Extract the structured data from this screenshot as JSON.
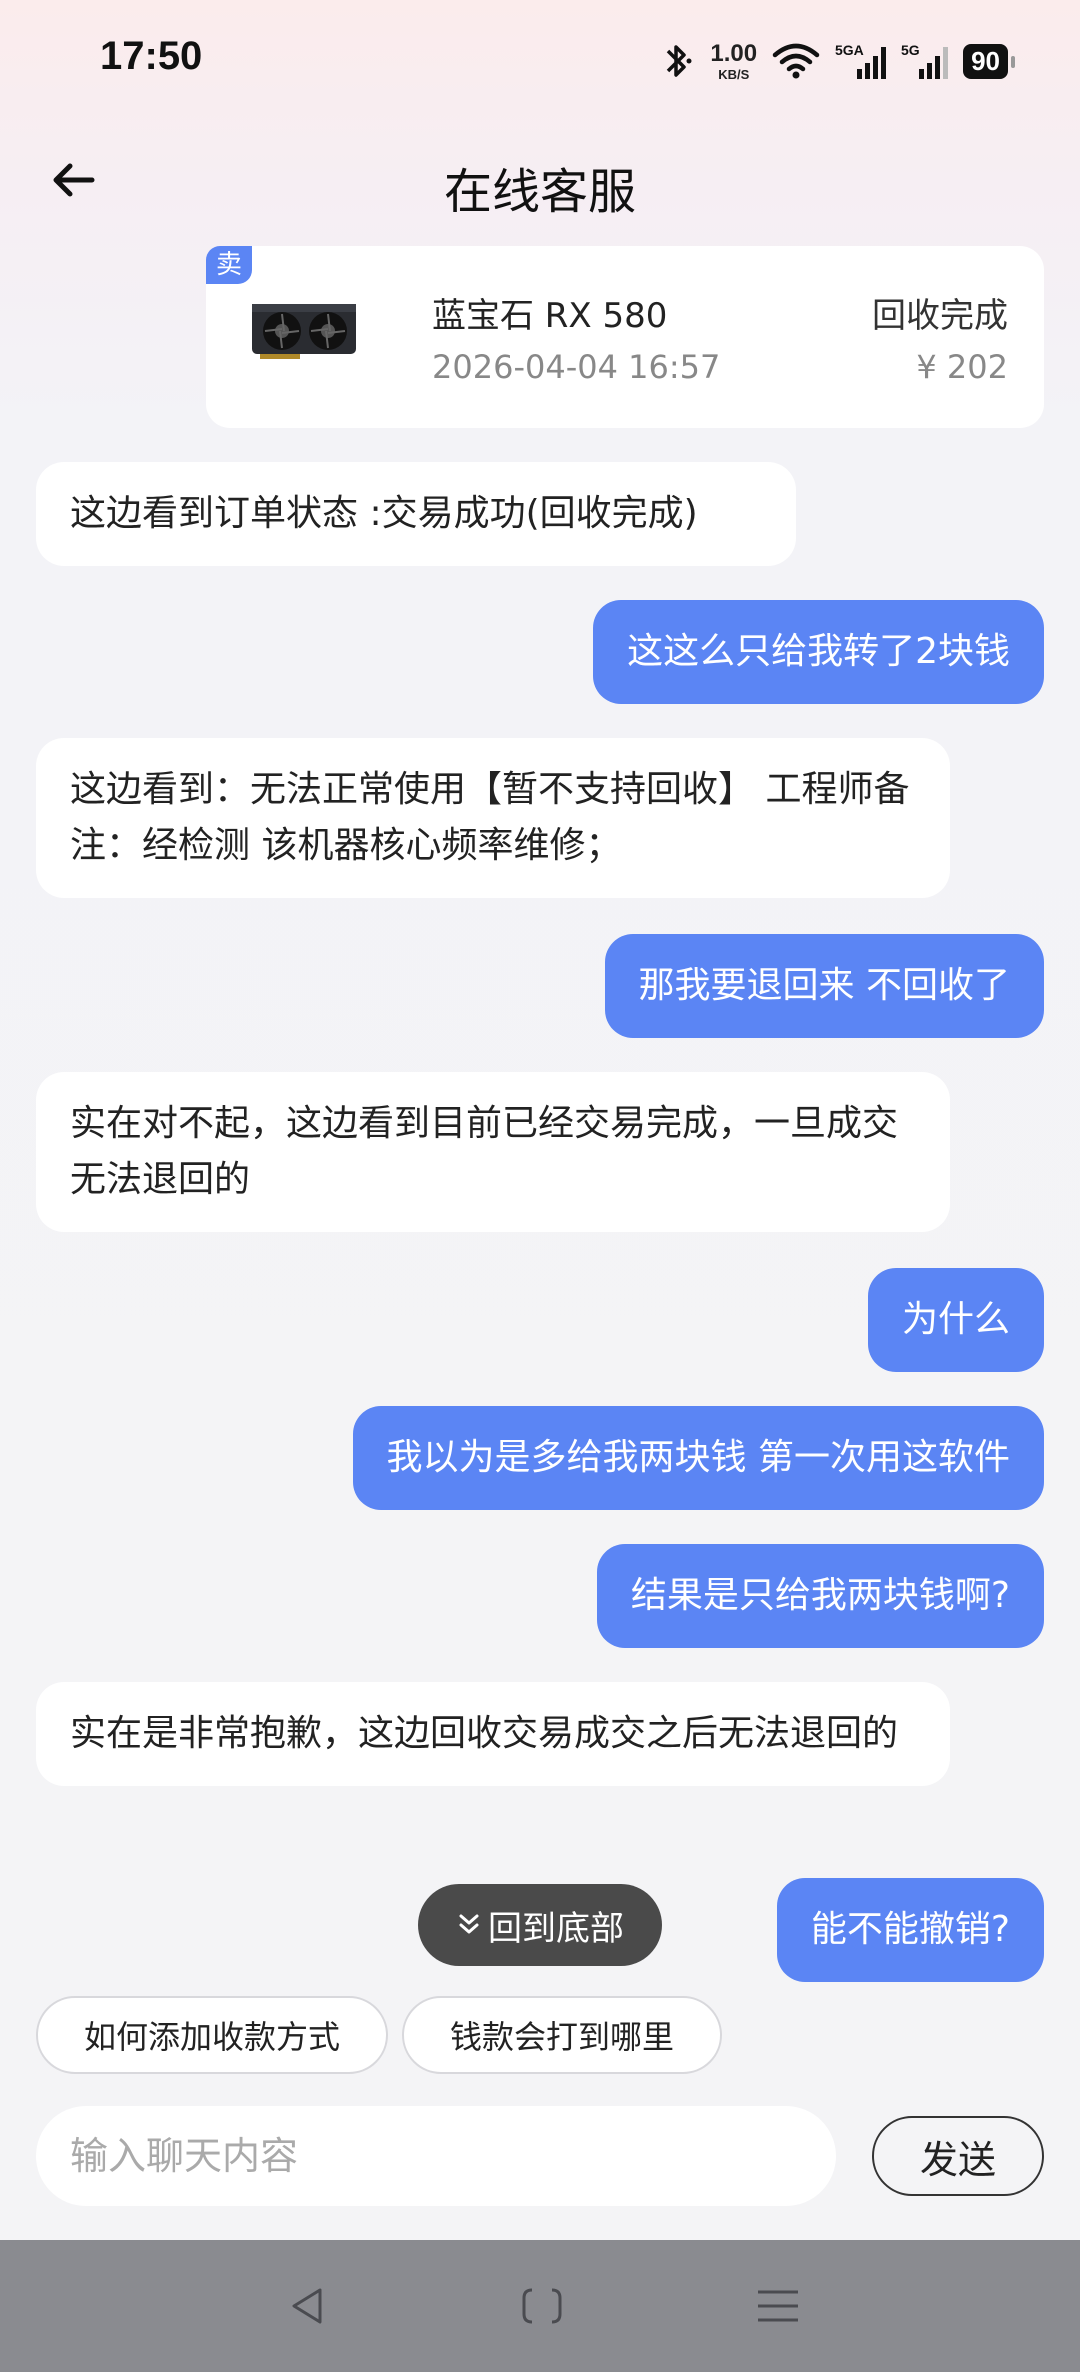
{
  "status_bar": {
    "time": "17:50",
    "net_speed": "1.00",
    "net_unit": "KB/S",
    "signal1": "5GA",
    "signal2": "5G",
    "battery": "90"
  },
  "header": {
    "title": "在线客服"
  },
  "order": {
    "tag": "卖",
    "product": "蓝宝石 RX 580",
    "date": "2026-04-04 16:57",
    "status": "回收完成",
    "price": "¥ 202"
  },
  "messages": [
    {
      "from": "agent",
      "text": "这边看到订单状态 :交易成功(回收完成)"
    },
    {
      "from": "user",
      "text": "这这么只给我转了2块钱"
    },
    {
      "from": "agent",
      "text": "这边看到：无法正常使用【暂不支持回收】 工程师备注：经检测 该机器核心频率维修；"
    },
    {
      "from": "user",
      "text": "那我要退回来 不回收了"
    },
    {
      "from": "agent",
      "text": "实在对不起，这边看到目前已经交易完成，一旦成交无法退回的"
    },
    {
      "from": "user",
      "text": "为什么"
    },
    {
      "from": "user",
      "text": "我以为是多给我两块钱 第一次用这软件"
    },
    {
      "from": "user",
      "text": "结果是只给我两块钱啊?"
    },
    {
      "from": "agent",
      "text": "实在是非常抱歉，这边回收交易成交之后无法退回的"
    },
    {
      "from": "user",
      "text": "能不能撤销?"
    }
  ],
  "scroll_to_bottom": {
    "icon": "double-chevron-down-icon",
    "label": "回到底部"
  },
  "quick_replies": [
    "如何添加收款方式",
    "钱款会打到哪里"
  ],
  "composer": {
    "placeholder": "输入聊天内容",
    "send_label": "发送"
  },
  "colors": {
    "accent": "#5b85f4",
    "agent_bubble": "#ffffff",
    "nav_bar": "#8a8b90"
  }
}
